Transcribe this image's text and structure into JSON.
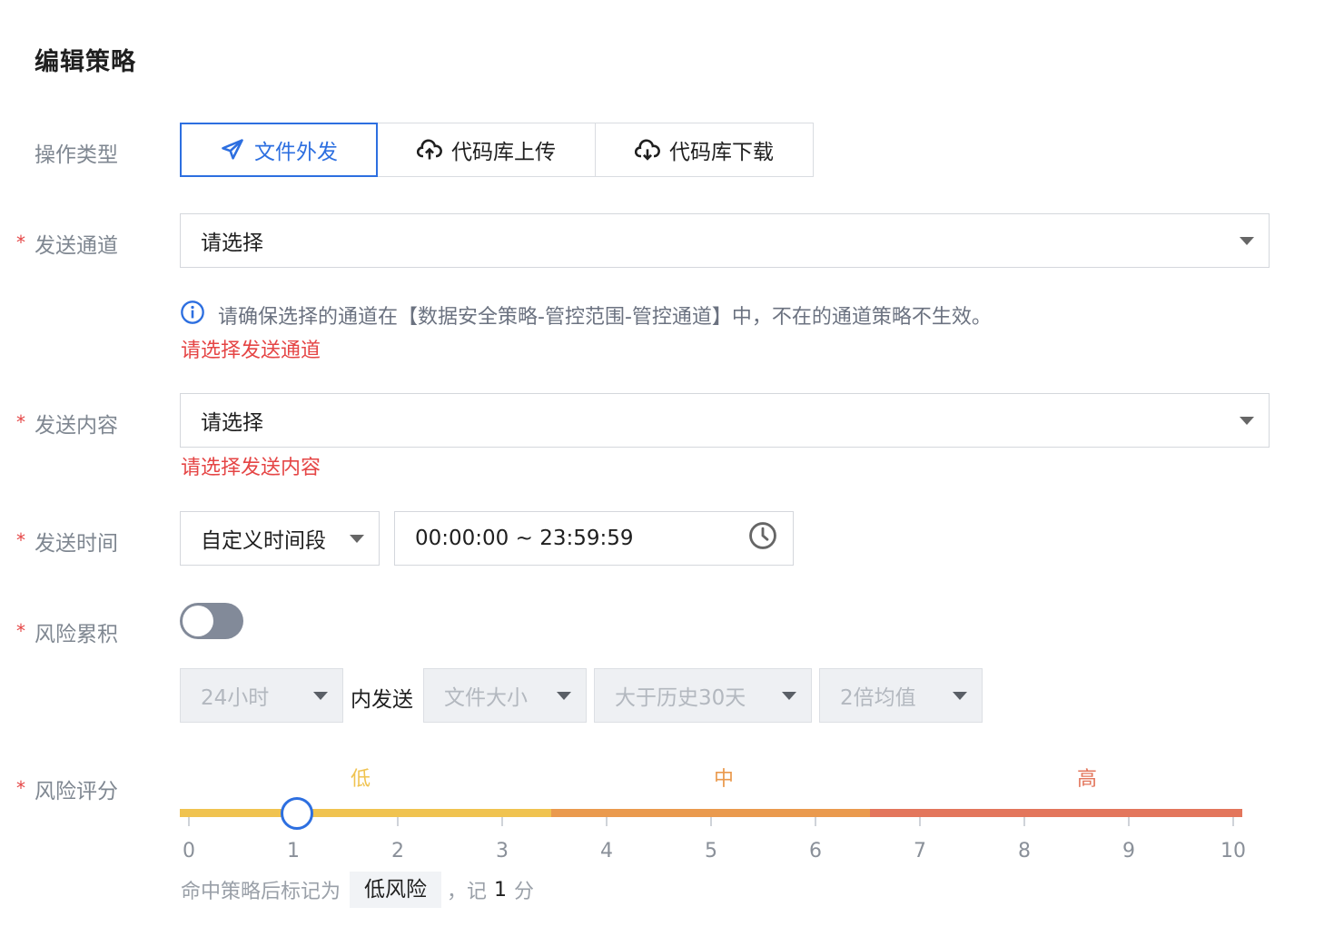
{
  "page": {
    "title": "编辑策略"
  },
  "op_type": {
    "label": "操作类型",
    "tabs": [
      {
        "label": "文件外发",
        "icon": "send-icon",
        "active": true
      },
      {
        "label": "代码库上传",
        "icon": "cloud-upload-icon",
        "active": false
      },
      {
        "label": "代码库下载",
        "icon": "cloud-download-icon",
        "active": false
      }
    ]
  },
  "channel": {
    "required": "*",
    "label": "发送通道",
    "value": "请选择",
    "hint": "请确保选择的通道在【数据安全策略-管控范围-管控通道】中，不在的通道策略不生效。",
    "error": "请选择发送通道"
  },
  "content": {
    "required": "*",
    "label": "发送内容",
    "value": "请选择",
    "error": "请选择发送内容"
  },
  "send_time": {
    "required": "*",
    "label": "发送时间",
    "mode": "自定义时间段",
    "range": "00:00:00 ~ 23:59:59"
  },
  "accumulate": {
    "required": "*",
    "label": "风险累积",
    "enabled": false,
    "period": "24小时",
    "connector": "内发送",
    "metric": "文件大小",
    "compare": "大于历史30天",
    "multiplier": "2倍均值"
  },
  "risk_score": {
    "required": "*",
    "label": "风险评分",
    "levels": [
      {
        "name": "低",
        "color": "#f0c350"
      },
      {
        "name": "中",
        "color": "#ea9a4e"
      },
      {
        "name": "高",
        "color": "#e3765c"
      }
    ],
    "ticks": [
      "0",
      "1",
      "2",
      "3",
      "4",
      "5",
      "6",
      "7",
      "8",
      "9",
      "10"
    ],
    "min": 0,
    "max": 10,
    "value": 1,
    "result_prefix": "命中策略后标记为",
    "result_tag": "低风险",
    "result_mid": "，记",
    "result_score": "1",
    "result_suffix": "分"
  },
  "colors": {
    "accent": "#2d6fe0",
    "error": "#e54545"
  }
}
